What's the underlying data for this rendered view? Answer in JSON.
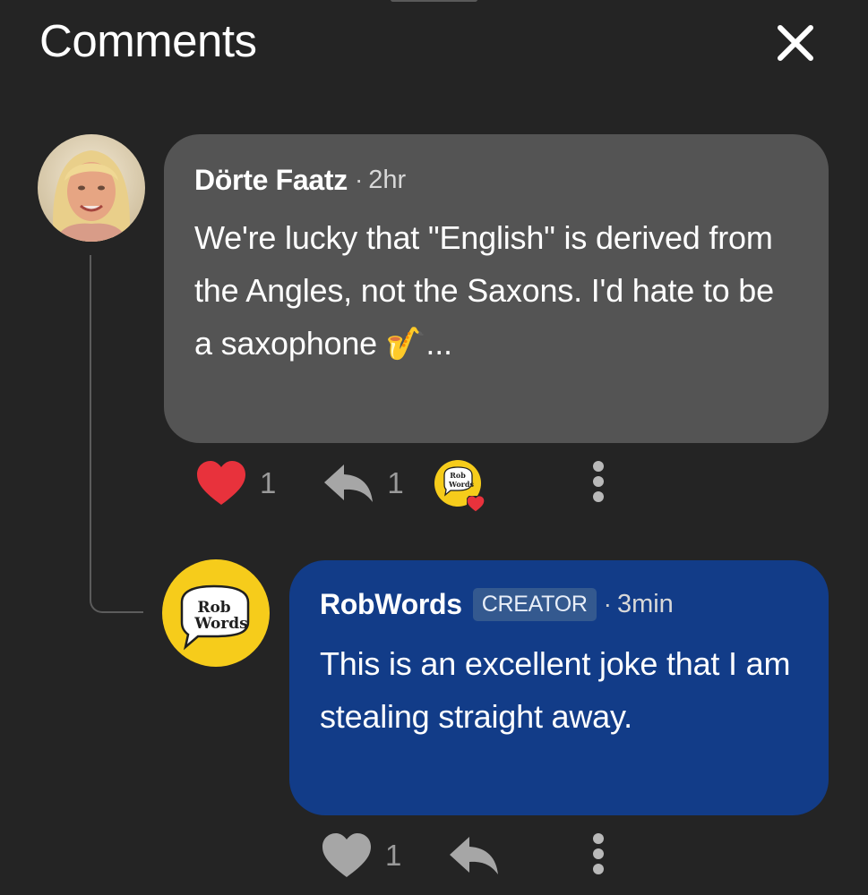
{
  "header": {
    "title": "Comments"
  },
  "comments": [
    {
      "author": "Dörte Faatz",
      "time": "2hr",
      "text": "We're lucky that \"English\" is derived from the Angles, not the Saxons.  I'd hate to be a saxophone 🎷...",
      "likes": "1",
      "replies": "1",
      "liked": true,
      "creator_reacted": true
    },
    {
      "author": "RobWords",
      "badge": "CREATOR",
      "time": "3min",
      "text": "This is an excellent joke that I am stealing straight away.",
      "likes": "1",
      "liked": false
    }
  ],
  "logo": {
    "line1": "Rob",
    "line2": "Words"
  },
  "colors": {
    "background": "#242424",
    "user_bubble": "#545454",
    "creator_bubble": "#123c88",
    "like_active": "#e8323c",
    "logo_yellow": "#f6cc1b"
  },
  "icons": {
    "close": "close-icon",
    "like": "heart-icon",
    "reply": "reply-icon",
    "more": "more-vertical-icon"
  }
}
